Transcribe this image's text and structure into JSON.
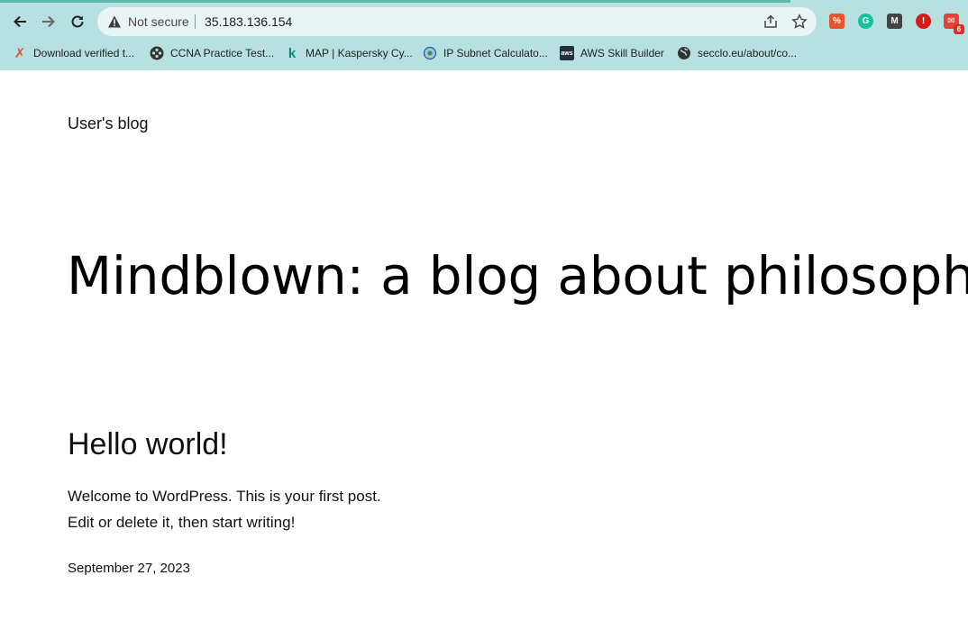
{
  "browser": {
    "security_label": "Not secure",
    "url": "35.183.136.154",
    "mail_badge_count": "6",
    "icons": [
      "back-icon",
      "forward-icon",
      "reload-icon",
      "warning-icon",
      "share-icon",
      "star-icon"
    ],
    "colors": {
      "toolbar": "#b7e0e0",
      "omnibox": "#e9f4f4",
      "progress": "#5fb7b0"
    }
  },
  "bookmarks": [
    {
      "label": "Download verified t...",
      "icon": "x-icon"
    },
    {
      "label": "CCNA Practice Test...",
      "icon": "film-icon"
    },
    {
      "label": "MAP | Kaspersky Cy...",
      "icon": "kaspersky-icon"
    },
    {
      "label": "IP Subnet Calculato...",
      "icon": "globe-disc-icon"
    },
    {
      "label": "AWS Skill Builder",
      "icon": "aws-icon"
    },
    {
      "label": "secclo.eu/about/co...",
      "icon": "globe-icon"
    }
  ],
  "page": {
    "site_title": "User's blog",
    "tagline": "Mindblown: a blog about philosophy.",
    "post": {
      "title": "Hello world!",
      "line1": "Welcome to WordPress. This is your first post.",
      "line2": "Edit or delete it, then start writing!",
      "date": "September 27, 2023"
    }
  }
}
